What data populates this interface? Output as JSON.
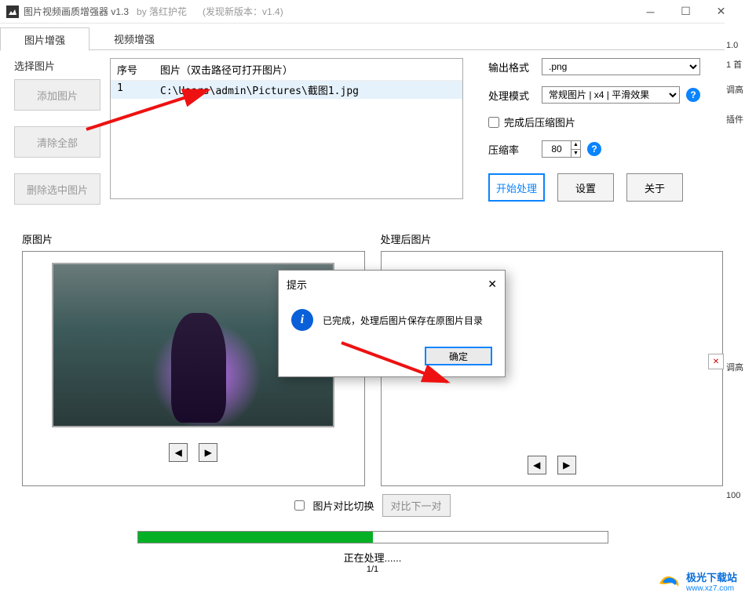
{
  "titlebar": {
    "app_title": "图片视频画质增强器 v1.3",
    "byline": "by 落红护花",
    "new_version": "(发现新版本：v1.4)"
  },
  "tabs": {
    "image": "图片增强",
    "video": "视频增强"
  },
  "left": {
    "group_label": "选择图片",
    "add": "添加图片",
    "clear": "清除全部",
    "delete_sel": "删除选中图片"
  },
  "filelist": {
    "col_num": "序号",
    "col_path": "图片（双击路径可打开图片）",
    "rows": [
      {
        "num": "1",
        "path": "C:\\Users\\admin\\Pictures\\截图1.jpg"
      }
    ]
  },
  "settings": {
    "output_format_label": "输出格式",
    "output_format_value": ".png",
    "mode_label": "处理模式",
    "mode_value": "常规图片 | x4 | 平滑效果",
    "compress_after": "完成后压缩图片",
    "compress_rate_label": "压缩率",
    "compress_rate_value": "80",
    "start": "开始处理",
    "settings_btn": "设置",
    "about": "关于"
  },
  "panels": {
    "original": "原图片",
    "processed": "处理后图片"
  },
  "bottom": {
    "compare_toggle": "图片对比切换",
    "compare_next": "对比下一对",
    "status": "正在处理......",
    "progress_count": "1/1"
  },
  "modal": {
    "title": "提示",
    "message": "已完成，处理后图片保存在原图片目录",
    "ok": "确定"
  },
  "right_edge": {
    "v": "1.0",
    "a": "1 首",
    "b": "调高",
    "c": "插件",
    "d": "调高",
    "e": "100"
  },
  "watermark": {
    "name": "极光下载站",
    "url": "www.xz7.com"
  }
}
